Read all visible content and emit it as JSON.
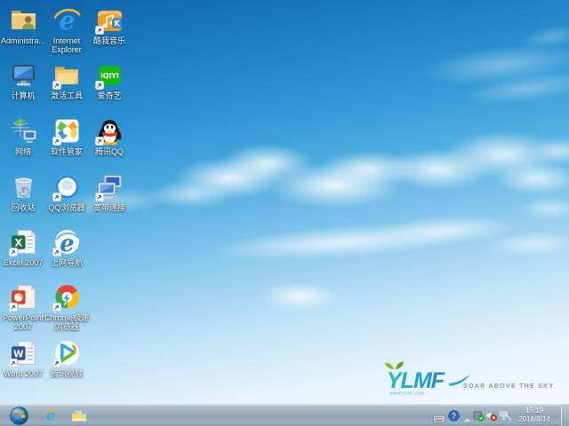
{
  "wallpaper": {
    "brand": "YLMF",
    "brand_url": "WWW.YLMF.COM",
    "tagline": "SOAR ABOVE THE SKY",
    "colors": {
      "sky_top": "#0e62a6",
      "sky_mid": "#4fade0",
      "sky_bottom": "#f7fcfe",
      "brand_teal": "#28b6c8",
      "brand_blue": "#1a8fd0",
      "leaf_green": "#7ec225",
      "tagline_gray": "#8b949b"
    }
  },
  "desktop": {
    "icons": [
      {
        "name": "administrator-folder",
        "label": "Administra...",
        "art": "admin_folder",
        "shortcut": false,
        "col": 0,
        "row": 0
      },
      {
        "name": "internet-explorer",
        "label": "Internet\nExplorer",
        "art": "ie",
        "shortcut": false,
        "col": 1,
        "row": 0
      },
      {
        "name": "kuwo-music",
        "label": "酷我音乐",
        "art": "kuwo",
        "shortcut": true,
        "col": 2,
        "row": 0
      },
      {
        "name": "computer",
        "label": "计算机",
        "art": "computer",
        "shortcut": false,
        "col": 0,
        "row": 1
      },
      {
        "name": "activation-tools",
        "label": "激活工具",
        "art": "folder",
        "shortcut": true,
        "col": 1,
        "row": 1
      },
      {
        "name": "iqiyi",
        "label": "爱奇艺",
        "art": "iqiyi",
        "shortcut": true,
        "col": 2,
        "row": 1
      },
      {
        "name": "network",
        "label": "网络",
        "art": "network",
        "shortcut": false,
        "col": 0,
        "row": 2
      },
      {
        "name": "software-manager",
        "label": "软件管家",
        "art": "softmgr",
        "shortcut": true,
        "col": 1,
        "row": 2
      },
      {
        "name": "tencent-qq",
        "label": "腾讯QQ",
        "art": "qq",
        "shortcut": true,
        "col": 2,
        "row": 2
      },
      {
        "name": "recycle-bin",
        "label": "回收站",
        "art": "recycle",
        "shortcut": false,
        "col": 0,
        "row": 3
      },
      {
        "name": "qq-browser",
        "label": "QQ浏览器",
        "art": "qqbrowser",
        "shortcut": true,
        "col": 1,
        "row": 3
      },
      {
        "name": "broadband-connection",
        "label": "宽带连接",
        "art": "broadband",
        "shortcut": true,
        "col": 2,
        "row": 3
      },
      {
        "name": "excel-2007",
        "label": "Excel 2007",
        "art": "excel",
        "shortcut": true,
        "col": 0,
        "row": 4
      },
      {
        "name": "web-navigation",
        "label": "上网导航",
        "art": "nav_e",
        "shortcut": true,
        "col": 1,
        "row": 4
      },
      {
        "name": "powerpoint-2007",
        "label": "PowerPoint\n2007",
        "art": "powerpoint",
        "shortcut": true,
        "col": 0,
        "row": 5
      },
      {
        "name": "chrome-speed-browser",
        "label": "Chrome极速\n浏览器",
        "art": "chrome",
        "shortcut": true,
        "col": 1,
        "row": 5
      },
      {
        "name": "word-2007",
        "label": "Word 2007",
        "art": "word",
        "shortcut": true,
        "col": 0,
        "row": 6
      },
      {
        "name": "tencent-video",
        "label": "腾讯视频",
        "art": "tvideo",
        "shortcut": true,
        "col": 1,
        "row": 6
      }
    ]
  },
  "taskbar": {
    "tray": {
      "time": "15:19",
      "date": "2018/8/14"
    }
  }
}
